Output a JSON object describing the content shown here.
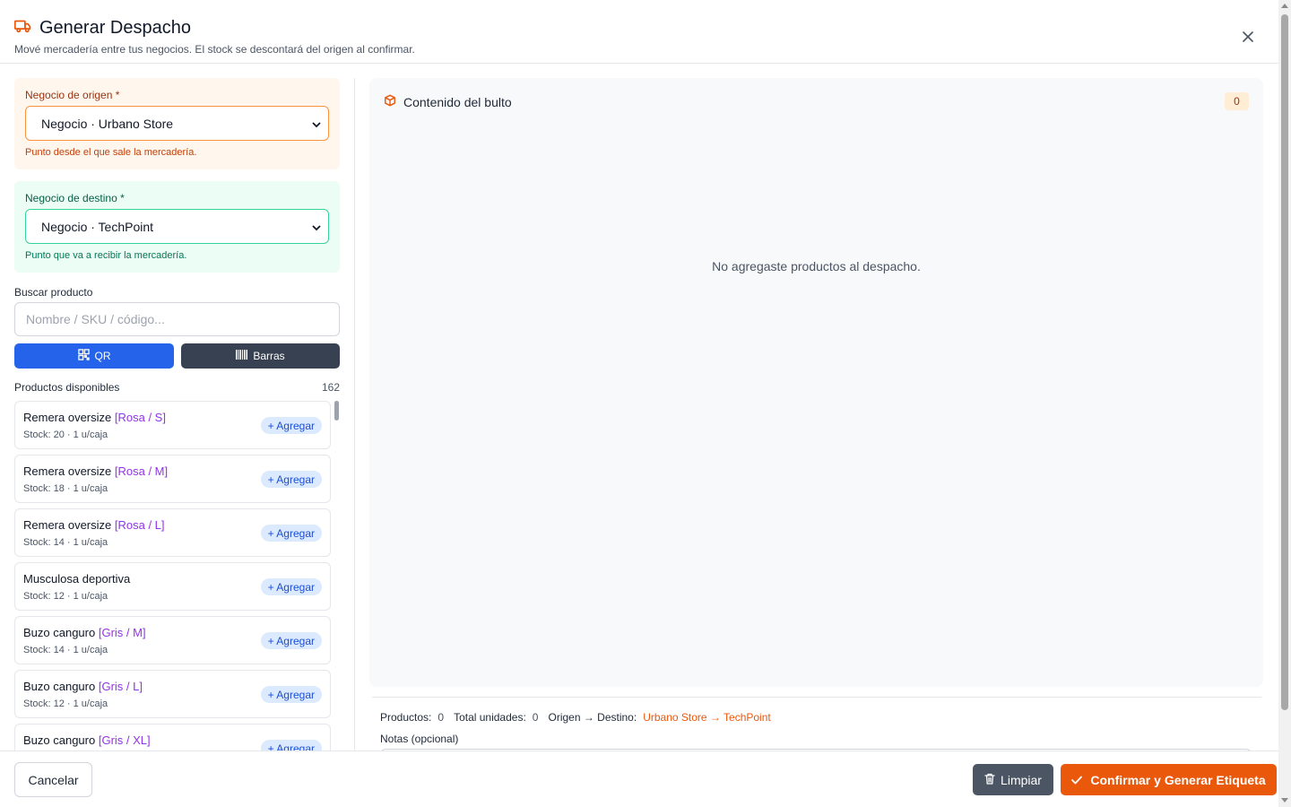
{
  "header": {
    "title": "Generar Despacho",
    "subtitle": "Mové mercadería entre tus negocios. El stock se descontará del origen al confirmar.",
    "icon": "truck-icon",
    "accent_color": "#ea580c"
  },
  "origin": {
    "label": "Negocio de origen *",
    "selected": "Negocio · Urbano Store",
    "hint": "Punto desde el que sale la mercadería."
  },
  "destination": {
    "label": "Negocio de destino *",
    "selected": "Negocio · TechPoint",
    "hint": "Punto que va a recibir la mercadería."
  },
  "search": {
    "label": "Buscar producto",
    "placeholder": "Nombre / SKU / código...",
    "value": "",
    "qr_label": "QR",
    "barcode_label": "Barras"
  },
  "products": {
    "label": "Productos disponibles",
    "count": "162",
    "add_label": "+ Agregar",
    "items": [
      {
        "name": "Remera oversize",
        "variant": "[Rosa / S]",
        "stock": "Stock: 20 · 1 u/caja"
      },
      {
        "name": "Remera oversize",
        "variant": "[Rosa / M]",
        "stock": "Stock: 18 · 1 u/caja"
      },
      {
        "name": "Remera oversize",
        "variant": "[Rosa / L]",
        "stock": "Stock: 14 · 1 u/caja"
      },
      {
        "name": "Musculosa deportiva",
        "variant": "",
        "stock": "Stock: 12 · 1 u/caja"
      },
      {
        "name": "Buzo canguro",
        "variant": "[Gris / M]",
        "stock": "Stock: 14 · 1 u/caja"
      },
      {
        "name": "Buzo canguro",
        "variant": "[Gris / L]",
        "stock": "Stock: 12 · 1 u/caja"
      },
      {
        "name": "Buzo canguro",
        "variant": "[Gris / XL]",
        "stock": ""
      }
    ]
  },
  "package": {
    "title": "Contenido del bulto",
    "count": "0",
    "empty_message": "No agregaste productos al despacho."
  },
  "summary": {
    "products_label": "Productos:",
    "products_value": "0",
    "units_label": "Total unidades:",
    "units_value": "0",
    "route_label": "Origen → Destino:",
    "route_value": "Urbano Store → TechPoint",
    "notes_label": "Notas (opcional)"
  },
  "footer": {
    "cancel_label": "Cancelar",
    "clear_label": "Limpiar",
    "confirm_label": "Confirmar y Generar Etiqueta"
  }
}
